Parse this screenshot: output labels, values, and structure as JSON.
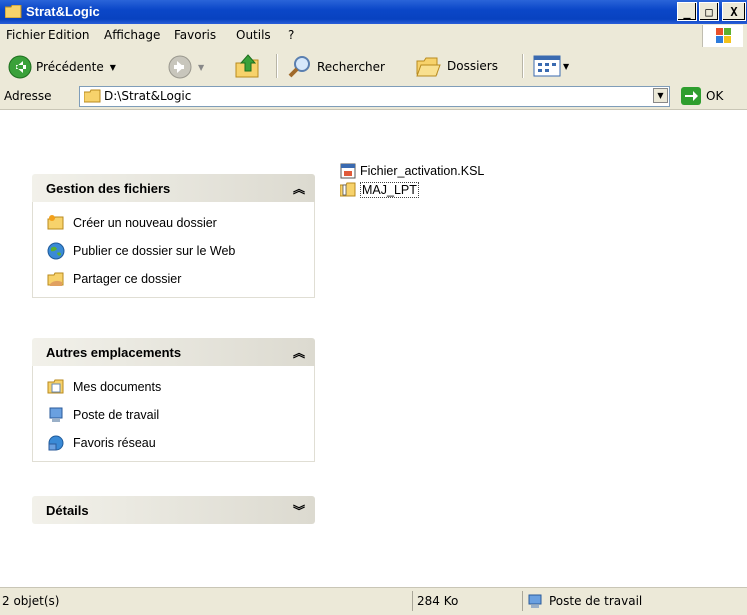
{
  "window": {
    "title": "Strat&Logic",
    "minimize": "_",
    "maximize": "□",
    "close": "X"
  },
  "menu": [
    {
      "label": "Fichier"
    },
    {
      "label": "Edition"
    },
    {
      "label": "Affichage"
    },
    {
      "label": "Favoris"
    },
    {
      "label": "Outils"
    },
    {
      "label": "?"
    }
  ],
  "toolbar": {
    "back_label": "Précédente",
    "search_label": "Rechercher",
    "folders_label": "Dossiers"
  },
  "address": {
    "label": "Adresse",
    "value": "D:\\Strat&Logic",
    "go_label": "OK"
  },
  "panels": {
    "file_tasks": {
      "title": "Gestion des fichiers",
      "items": [
        {
          "label": "Créer un nouveau dossier",
          "icon": "new-folder-icon"
        },
        {
          "label": "Publier ce dossier sur le Web",
          "icon": "publish-web-icon"
        },
        {
          "label": "Partager ce dossier",
          "icon": "share-folder-icon"
        }
      ]
    },
    "other_places": {
      "title": "Autres emplacements",
      "items": [
        {
          "label": "Mes documents",
          "icon": "my-documents-icon"
        },
        {
          "label": "Poste de travail",
          "icon": "my-computer-icon"
        },
        {
          "label": "Favoris réseau",
          "icon": "network-places-icon"
        }
      ]
    },
    "details": {
      "title": "Détails"
    }
  },
  "files": [
    {
      "name": "Fichier_activation.KSL",
      "icon": "ksl-file-icon"
    },
    {
      "name": "MAJ_LPT",
      "icon": "zip-folder-icon"
    }
  ],
  "status": {
    "objects": "2 objet(s)",
    "size": "284 Ko",
    "location": "Poste de travail"
  },
  "colors": {
    "titlebar": "#0b47c8",
    "chrome": "#ece9d8",
    "panel_head": "#dcdad0"
  }
}
